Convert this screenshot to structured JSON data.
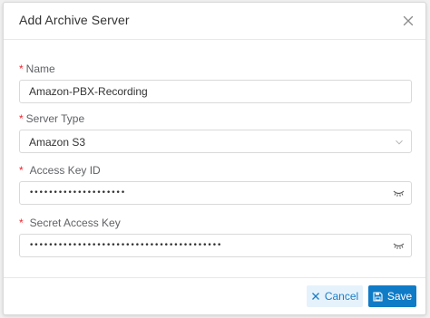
{
  "dialog": {
    "title": "Add Archive Server",
    "close_icon": "close-icon"
  },
  "form": {
    "required_mark": "*",
    "name": {
      "label": "Name",
      "value": "Amazon-PBX-Recording"
    },
    "server_type": {
      "label": "Server Type",
      "value": "Amazon S3",
      "icon": "chevron-down-icon"
    },
    "access_key_id": {
      "label": "Access Key ID",
      "value": "••••••••••••••••••••",
      "icon": "eye-closed-icon"
    },
    "secret_access_key": {
      "label": "Secret Access Key",
      "value": "••••••••••••••••••••••••••••••••••••••••",
      "icon": "eye-closed-icon"
    }
  },
  "footer": {
    "cancel_label": "Cancel",
    "cancel_icon": "close-icon",
    "save_label": "Save",
    "save_icon": "save-icon"
  },
  "colors": {
    "primary": "#0f7bc7",
    "cancel_bg": "#e6f2fb",
    "required": "#f5222d"
  }
}
